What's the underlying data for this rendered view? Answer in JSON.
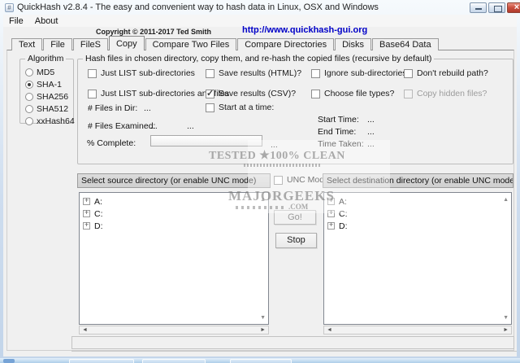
{
  "window": {
    "title": "QuickHash v2.8.4 - The easy and convenient way to hash data in Linux, OSX and Windows",
    "menu": [
      "File",
      "About"
    ],
    "copyright": "Copyright © 2011-2017 Ted Smith",
    "url": "http://www.quickhash-gui.org"
  },
  "tabs": [
    {
      "label": "Text",
      "active": false
    },
    {
      "label": "File",
      "active": false
    },
    {
      "label": "FileS",
      "active": false
    },
    {
      "label": "Copy",
      "active": true
    },
    {
      "label": "Compare Two Files",
      "active": false
    },
    {
      "label": "Compare Directories",
      "active": false
    },
    {
      "label": "Disks",
      "active": false
    },
    {
      "label": "Base64 Data",
      "active": false
    }
  ],
  "algorithm": {
    "label": "Algorithm",
    "options": [
      {
        "label": "MD5",
        "selected": false
      },
      {
        "label": "SHA-1",
        "selected": true
      },
      {
        "label": "SHA256",
        "selected": false
      },
      {
        "label": "SHA512",
        "selected": false
      },
      {
        "label": "xxHash64",
        "selected": false
      }
    ]
  },
  "copy": {
    "group_title": "Hash files in chosen directory, copy them, and re-hash the copied files (recursive by default)",
    "checkboxes": [
      {
        "label": "Just LIST sub-directories",
        "checked": false,
        "disabled": false
      },
      {
        "label": "Just LIST sub-directories and files",
        "checked": false,
        "disabled": false
      },
      {
        "label": "Save results (HTML)?",
        "checked": false,
        "disabled": false
      },
      {
        "label": "Save results (CSV)?",
        "checked": true,
        "disabled": false
      },
      {
        "label": "Ignore sub-directories?",
        "checked": false,
        "disabled": false
      },
      {
        "label": "Choose file types?",
        "checked": false,
        "disabled": false
      },
      {
        "label": "Don't rebuild path?",
        "checked": false,
        "disabled": false
      },
      {
        "label": "Copy hidden files?",
        "checked": false,
        "disabled": true
      },
      {
        "label": "Start at a time:",
        "checked": false,
        "disabled": false
      }
    ],
    "files_in_dir": {
      "label": "# Files in Dir:",
      "value": "..."
    },
    "files_examined": {
      "label": "# Files Examined:",
      "value": "...",
      "value2": "..."
    },
    "percent": {
      "label": "% Complete:",
      "value": "..."
    },
    "start_time": {
      "label": "Start Time:",
      "value": "..."
    },
    "end_time": {
      "label": "End Time:",
      "value": "..."
    },
    "time_taken": {
      "label": "Time Taken:",
      "value": "..."
    }
  },
  "panels": {
    "unc_label": "UNC Mode?",
    "source": {
      "header": "Select source directory (or enable UNC mode)",
      "items": [
        "A:",
        "C:",
        "D:"
      ]
    },
    "dest": {
      "header": "Select destination directory (or enable UNC mode)",
      "items": [
        "A:",
        "C:",
        "D:"
      ]
    }
  },
  "actions": {
    "go": "Go!",
    "stop": "Stop"
  },
  "watermark": {
    "line1": "TESTED ★100% CLEAN",
    "line2": "MAJORGEEKS",
    "line3": ".COM"
  },
  "colors": {
    "url_link": "#0000C8",
    "titlebar_top": "#F6FAFD",
    "titlebar_bottom": "#CEDDEF",
    "close_red": "#C9503F",
    "client_bg": "#F0F0F0"
  }
}
